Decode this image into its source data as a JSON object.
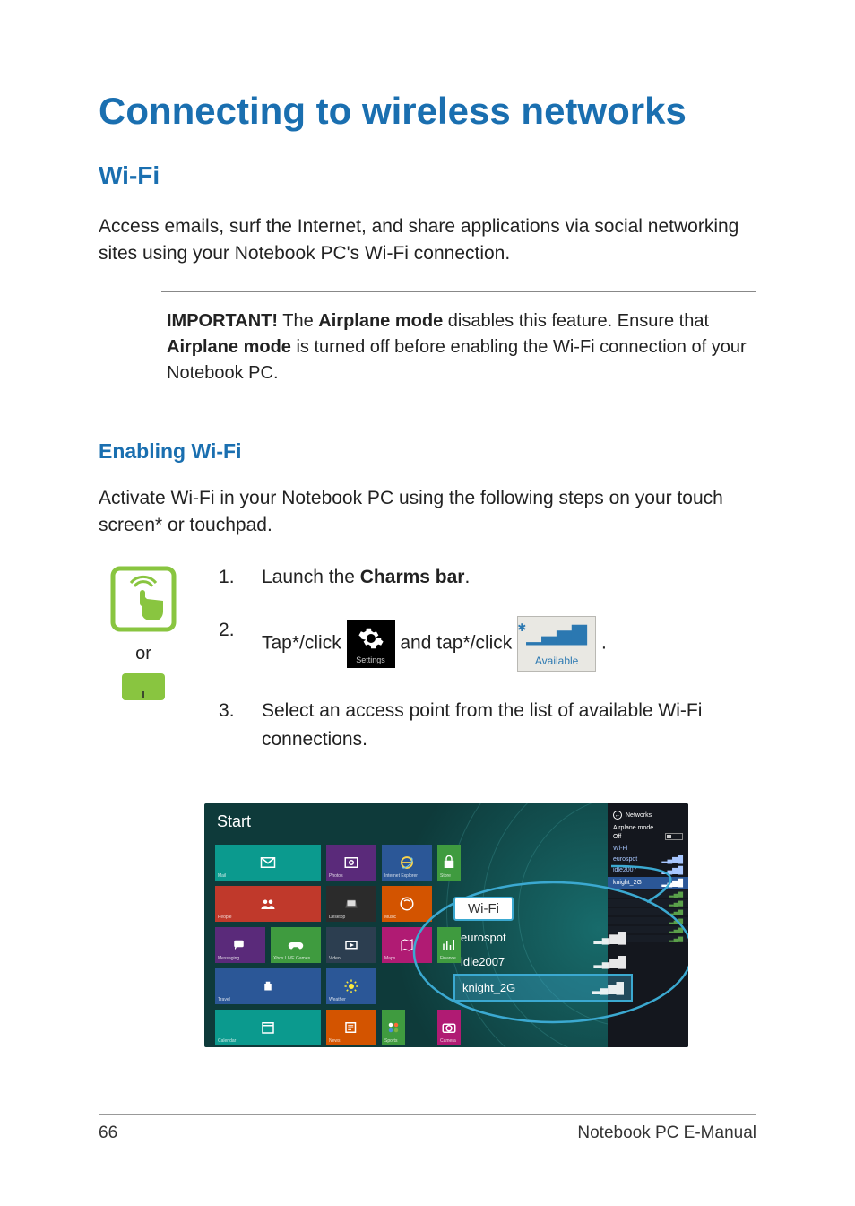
{
  "page": {
    "number": "66",
    "footer_label": "Notebook PC E-Manual",
    "title": "Connecting to wireless networks",
    "wifi_heading": "Wi-Fi",
    "intro": "Access emails, surf the Internet, and share applications via social networking sites using your Notebook PC's Wi-Fi connection.",
    "important_label": "IMPORTANT!",
    "important_a": " The ",
    "important_b": "Airplane mode",
    "important_c": " disables this feature. Ensure that ",
    "important_d": "Airplane mode",
    "important_e": " is turned off before enabling the Wi-Fi connection of your Notebook PC.",
    "enable_heading": "Enabling Wi-Fi",
    "enable_intro": "Activate Wi-Fi in your Notebook PC using the following steps on your touch screen* or touchpad.",
    "or_label": "or"
  },
  "steps": {
    "s1_a": "Launch the ",
    "s1_b": "Charms bar",
    "s1_c": ".",
    "s2_a": "Tap*/click ",
    "s2_b": " and tap*/click ",
    "s2_c": ".",
    "s3": "Select an access point from the list of available Wi-Fi connections."
  },
  "icons": {
    "settings_label": "Settings",
    "available_label": "Available"
  },
  "start": {
    "label": "Start",
    "tiles": [
      {
        "label": "Mail",
        "color": "c-teal",
        "w": 2,
        "icon": "mail"
      },
      {
        "label": "Photos",
        "color": "c-purple",
        "w": 1,
        "icon": "photo"
      },
      {
        "label": "Internet Explorer",
        "color": "c-blue",
        "w": 1,
        "icon": "ie"
      },
      {
        "label": "Store",
        "color": "c-green",
        "w": 1,
        "icon": "store",
        "half": true
      },
      {
        "label": "People",
        "color": "c-red",
        "w": 2,
        "icon": "people"
      },
      {
        "label": "Desktop",
        "color": "c-grey",
        "w": 1,
        "icon": "desktop"
      },
      {
        "label": "Music",
        "color": "c-orange",
        "w": 1,
        "icon": "music"
      },
      {
        "label": "",
        "color": "",
        "w": 1,
        "icon": "",
        "half": true,
        "empty": true
      },
      {
        "label": "Messaging",
        "color": "c-purple",
        "w": 1,
        "icon": "msg"
      },
      {
        "label": "Xbox LIVE Games",
        "color": "c-green",
        "w": 1,
        "icon": "game"
      },
      {
        "label": "Video",
        "color": "c-dkblue",
        "w": 1,
        "icon": "video"
      },
      {
        "label": "Maps",
        "color": "c-mag",
        "w": 1,
        "icon": "maps"
      },
      {
        "label": "Finance",
        "color": "c-green",
        "w": 1,
        "icon": "finance",
        "half": true
      },
      {
        "label": "Travel",
        "color": "c-blue",
        "w": 2,
        "icon": "travel"
      },
      {
        "label": "Weather",
        "color": "c-blue",
        "w": 1,
        "icon": "weather"
      },
      {
        "label": "",
        "color": "",
        "w": 1,
        "icon": "",
        "empty": true
      },
      {
        "label": "",
        "color": "",
        "w": 1,
        "icon": "",
        "half": true,
        "empty": true
      },
      {
        "label": "Calendar",
        "color": "c-teal",
        "w": 2,
        "icon": "cal"
      },
      {
        "label": "News",
        "color": "c-orange",
        "w": 1,
        "icon": "news"
      },
      {
        "label": "Sports",
        "color": "c-green",
        "w": 1,
        "icon": "sports",
        "half": true
      },
      {
        "label": "Camera",
        "color": "c-mag",
        "w": 1,
        "icon": "camera",
        "half": true
      }
    ]
  },
  "networks": {
    "title": "Networks",
    "airplane_label": "Airplane mode",
    "airplane_state": "Off",
    "section": "Wi-Fi",
    "top_items": [
      "eurospot",
      "idle2007",
      "knight_2G"
    ],
    "callout_label": "Wi-Fi",
    "callout_items": [
      {
        "name": "eurospot",
        "sel": false
      },
      {
        "name": "idle2007",
        "sel": false
      },
      {
        "name": "knight_2G",
        "sel": true
      }
    ]
  }
}
